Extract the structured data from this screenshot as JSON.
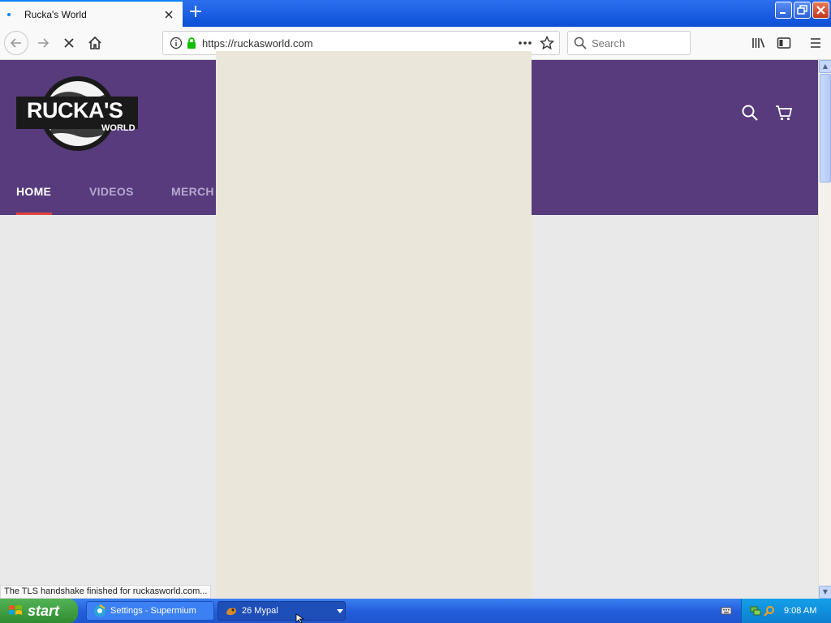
{
  "browser": {
    "tab_title": "Rucka's World",
    "new_tab_glyph": "+",
    "url": "https://ruckasworld.com",
    "search_placeholder": "Search",
    "status_text": "The TLS handshake finished for ruckasworld.com..."
  },
  "site": {
    "logo_main": "RUCKA'S",
    "logo_sub": "WORLD",
    "nav": [
      "HOME",
      "VIDEOS",
      "MERCH"
    ],
    "active_nav": "HOME"
  },
  "taskbar": {
    "start_label": "start",
    "tasks": [
      {
        "label": "Settings - Supermium",
        "icon": "supermium-icon"
      },
      {
        "label": "26 Mypal",
        "icon": "mypal-icon"
      }
    ],
    "clock": "9:08 AM"
  },
  "colors": {
    "header_purple": "#573b7d",
    "active_underline": "#e0443a",
    "accent_blue": "#0a84ff",
    "lock_green": "#12bc00"
  }
}
